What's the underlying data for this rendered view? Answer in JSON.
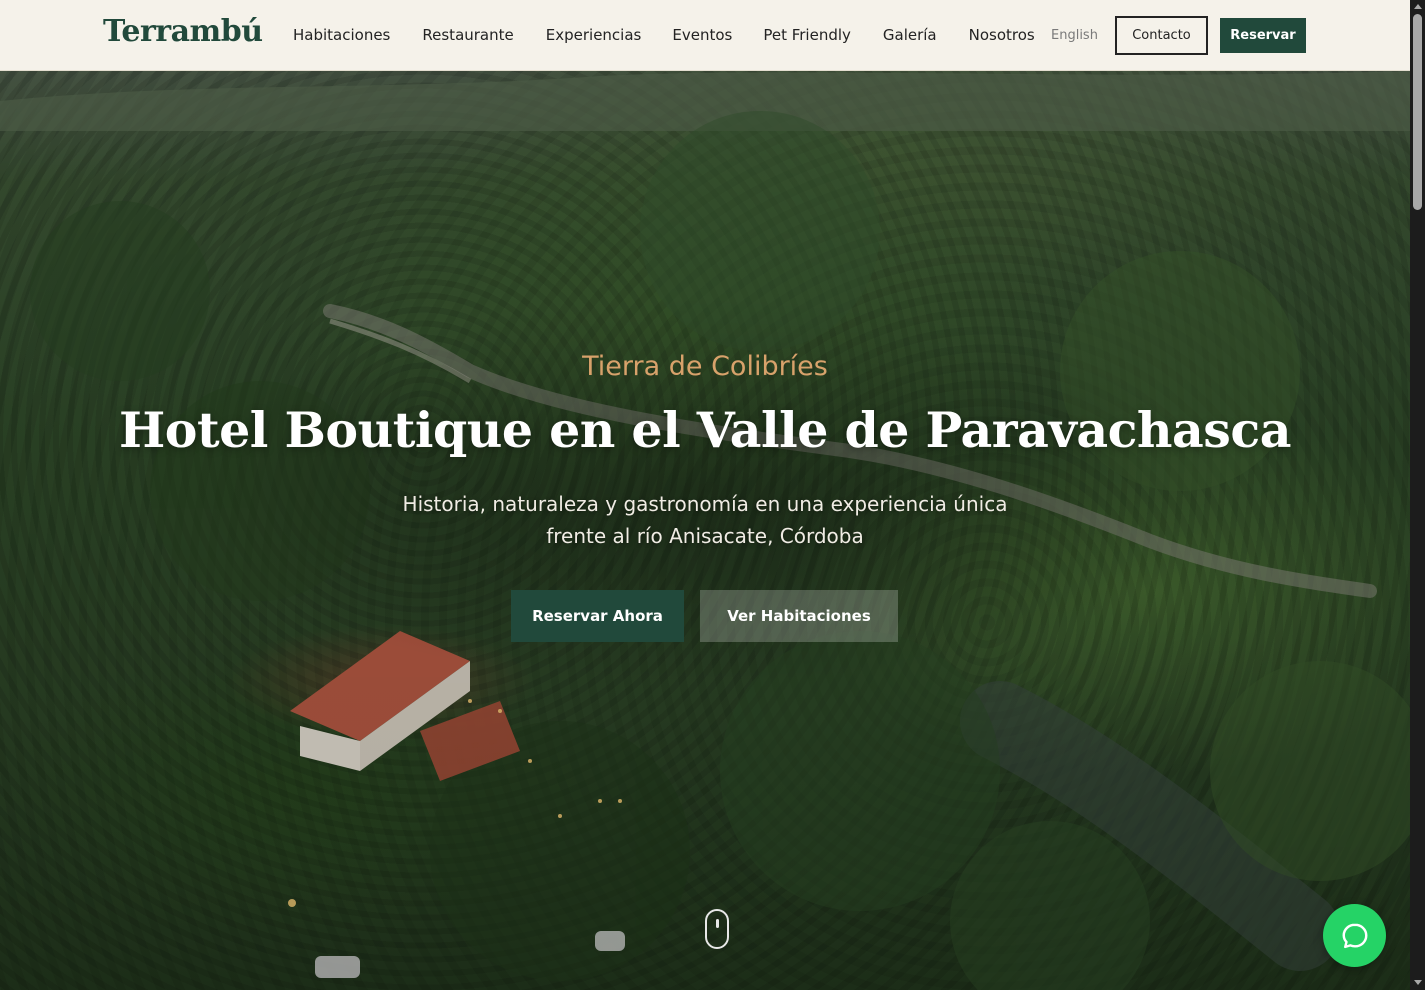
{
  "header": {
    "logo": "Terrambú",
    "nav": [
      {
        "label": "Habitaciones"
      },
      {
        "label": "Restaurante"
      },
      {
        "label": "Experiencias"
      },
      {
        "label": "Eventos"
      },
      {
        "label": "Pet Friendly"
      },
      {
        "label": "Galería"
      },
      {
        "label": "Nosotros"
      }
    ],
    "language": "English",
    "contact_label": "Contacto",
    "reserve_label": "Reservar"
  },
  "hero": {
    "tagline": "Tierra de Colibríes",
    "title": "Hotel Boutique en el Valle de Paravachasca",
    "subtitle_line1": "Historia, naturaleza y gastronomía en una experiencia única",
    "subtitle_line2": "frente al río Anisacate, Córdoba",
    "primary_cta": "Reservar Ahora",
    "secondary_cta": "Ver Habitaciones",
    "scroll_icon": "mouse-scroll-icon"
  },
  "floating": {
    "chat_icon": "whatsapp-chat-icon"
  },
  "colors": {
    "brand_green": "#21493b",
    "accent_gold": "#d8a26b",
    "header_bg": "#f5f2ea",
    "whatsapp_green": "#25d366"
  }
}
